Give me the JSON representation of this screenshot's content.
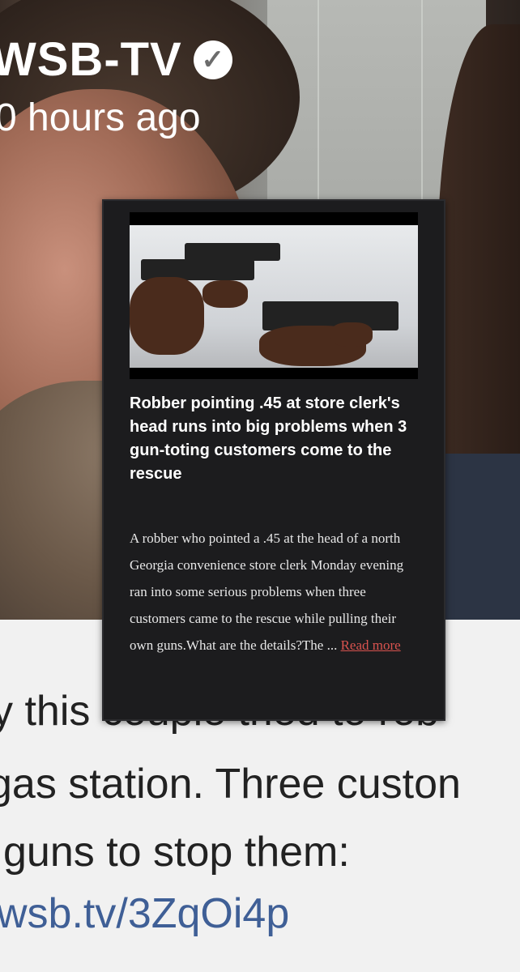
{
  "profile": {
    "name": "WSB-TV",
    "time_ago": "0 hours ago",
    "verified_icon": "verified-check-icon"
  },
  "card": {
    "title": "Robber pointing .45 at store clerk's head runs into big problems when 3 gun-toting customers come to the rescue",
    "body": "A robber who pointed a .45 at the head of a north Georgia convenience store clerk Monday evening ran into some serious problems when three customers came to the rescue while pulling their own guns.What are the details?The ...",
    "read_more": "Read more"
  },
  "tweet": {
    "line1": "y this couple tried to rob",
    "line2": "gas station. Three custon",
    "line3": "guns to stop them:",
    "link": "wsb.tv/3ZqOi4p"
  },
  "colors": {
    "link": "#3f5f96",
    "read_more": "#d9534f",
    "card_bg": "#1c1c1e"
  }
}
